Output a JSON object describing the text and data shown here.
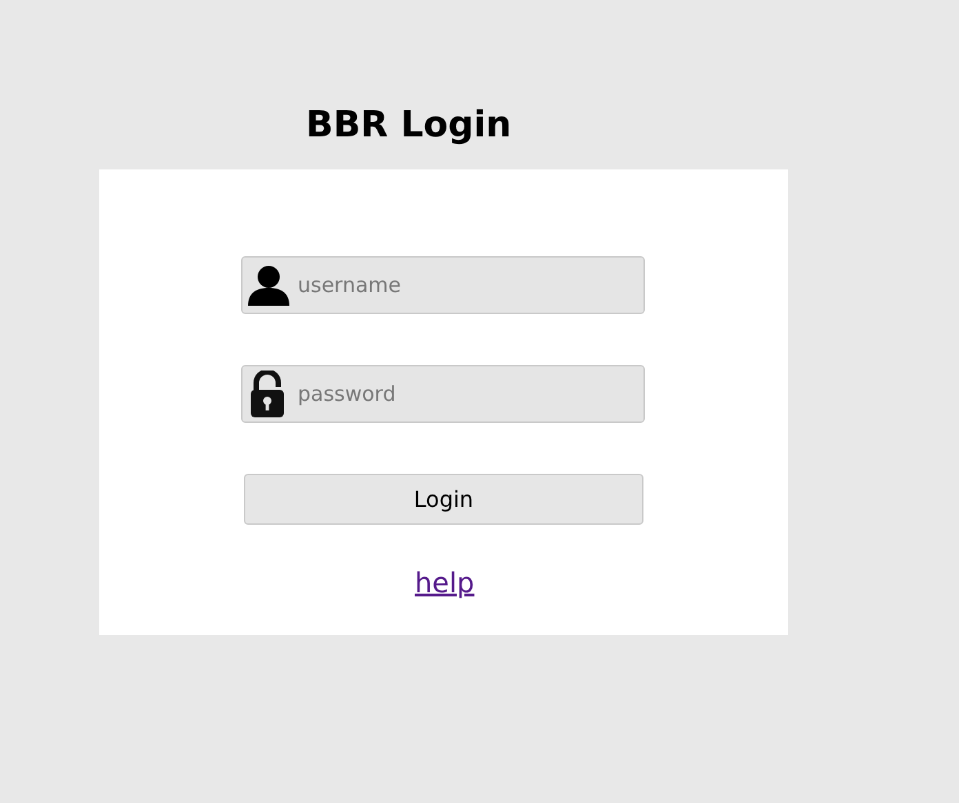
{
  "title": "BBR Login",
  "fields": [
    {
      "kind": "user",
      "placeholder": "username"
    },
    {
      "kind": "lock",
      "placeholder": "password"
    }
  ],
  "button": "Login",
  "link": "help"
}
